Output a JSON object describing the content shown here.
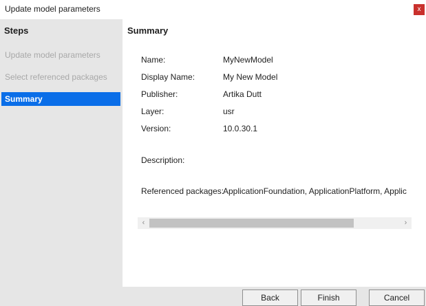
{
  "window": {
    "title": "Update model parameters",
    "close_label": "x"
  },
  "sidebar": {
    "header": "Steps",
    "items": [
      {
        "label": "Update model parameters",
        "state": "disabled"
      },
      {
        "label": "Select referenced packages",
        "state": "disabled"
      },
      {
        "label": "Summary",
        "state": "active"
      }
    ]
  },
  "summary": {
    "title": "Summary",
    "fields": {
      "name": {
        "label": "Name:",
        "value": "MyNewModel"
      },
      "display_name": {
        "label": "Display Name:",
        "value": "My New Model"
      },
      "publisher": {
        "label": "Publisher:",
        "value": "Artika Dutt"
      },
      "layer": {
        "label": "Layer:",
        "value": "usr"
      },
      "version": {
        "label": "Version:",
        "value": "10.0.30.1"
      },
      "description": {
        "label": "Description:",
        "value": ""
      },
      "referenced_packages": {
        "label": "Referenced packages:",
        "value": "ApplicationFoundation, ApplicationPlatform, Applic"
      }
    },
    "scrollbar": {
      "left_arrow": "‹",
      "right_arrow": "›"
    }
  },
  "footer": {
    "back_label": "Back",
    "finish_label": "Finish",
    "cancel_label": "Cancel"
  },
  "colors": {
    "accent": "#0a6ee8",
    "close_button": "#c9302c",
    "sidebar_bg": "#e6e6e6",
    "disabled_text": "#a8a8a8"
  }
}
